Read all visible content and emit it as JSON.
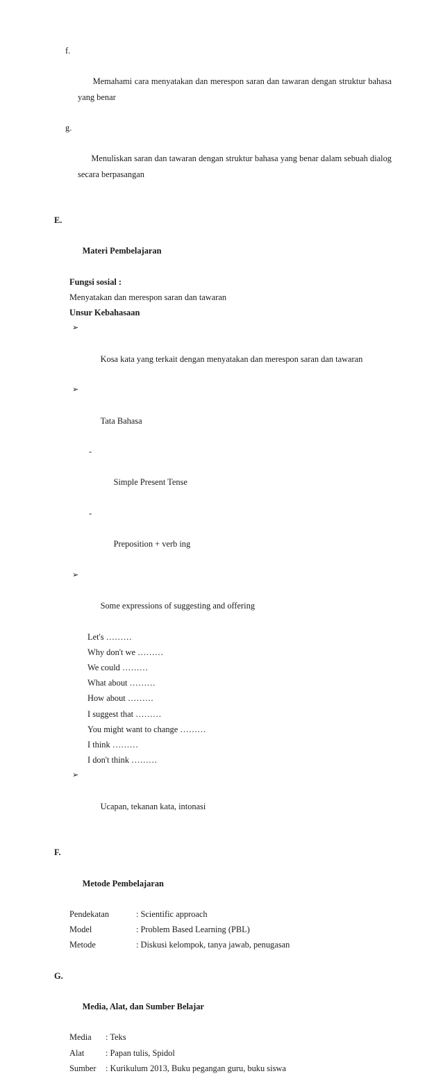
{
  "document": {
    "intro_list": [
      {
        "marker": "f.",
        "text": "Memahami cara menyatakan dan merespon saran dan tawaran dengan struktur bahasa yang benar"
      },
      {
        "marker": "g.",
        "text": "Menuliskan saran dan tawaran dengan struktur bahasa yang benar dalam sebuah dialog secara berpasangan"
      }
    ],
    "sections": [
      {
        "letter": "E.",
        "title": "Materi Pembelajaran",
        "subheading_1": "Fungsi sosial :",
        "fungsi_sosial_text": "Menyatakan dan merespon saran dan tawaran",
        "subheading_2": "Unsur Kebahasaan",
        "bullet_1": "Kosa kata yang terkait dengan menyatakan dan merespon saran dan tawaran",
        "bullet_2": "Tata Bahasa",
        "sub_bullets": [
          "Simple Present Tense",
          "Preposition + verb ing"
        ],
        "bullet_3": "Some expressions of suggesting and offering",
        "expressions": [
          "Let's ………",
          "Why don't we ………",
          "We could ………",
          "What about ………",
          "How about ………",
          "I suggest that ………",
          "You might want to change ………",
          "I think ………",
          "I don't think ………"
        ],
        "bullet_4": "Ucapan, tekanan kata, intonasi"
      },
      {
        "letter": "F.",
        "title": "Metode Pembelajaran",
        "rows": [
          {
            "label": "Pendekatan",
            "value": ": Scientific approach"
          },
          {
            "label": "Model",
            "value": ": Problem Based Learning (PBL)"
          },
          {
            "label": "Metode",
            "value": ": Diskusi kelompok, tanya jawab, penugasan"
          }
        ]
      },
      {
        "letter": "G.",
        "title": "Media, Alat, dan Sumber Belajar",
        "rows": [
          {
            "label": "Media",
            "value": ": Teks"
          },
          {
            "label": "Alat",
            "value": ": Papan tulis, Spidol"
          },
          {
            "label": "Sumber",
            "value": ": Kurikulum 2013, Buku pegangan guru, buku siswa"
          }
        ]
      }
    ],
    "icons": {
      "arrow_bullet": "➢",
      "dash_bullet": "-"
    }
  }
}
